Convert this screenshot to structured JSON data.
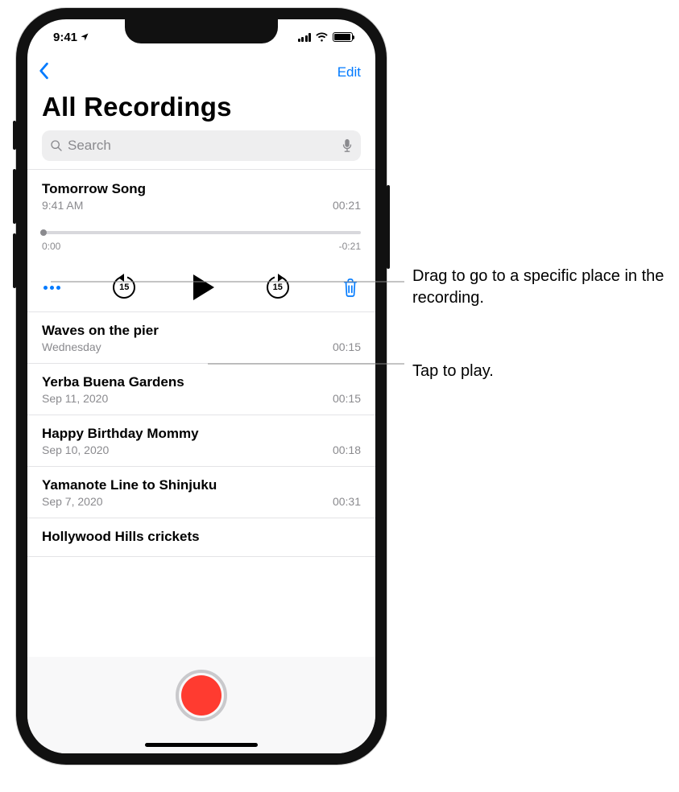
{
  "status": {
    "time": "9:41",
    "location_arrow": "➤"
  },
  "nav": {
    "edit_label": "Edit"
  },
  "page": {
    "title": "All Recordings"
  },
  "search": {
    "placeholder": "Search"
  },
  "expanded_recording": {
    "title": "Tomorrow Song",
    "time_label": "9:41 AM",
    "duration": "00:21",
    "slider_start": "0:00",
    "slider_end": "-0:21",
    "skip_back_num": "15",
    "skip_fwd_num": "15"
  },
  "recordings": [
    {
      "title": "Waves on the pier",
      "date": "Wednesday",
      "duration": "00:15"
    },
    {
      "title": "Yerba Buena Gardens",
      "date": "Sep 11, 2020",
      "duration": "00:15"
    },
    {
      "title": "Happy Birthday Mommy",
      "date": "Sep 10, 2020",
      "duration": "00:18"
    },
    {
      "title": "Yamanote Line to Shinjuku",
      "date": "Sep 7, 2020",
      "duration": "00:31"
    },
    {
      "title": "Hollywood Hills crickets",
      "date": "",
      "duration": ""
    }
  ],
  "callouts": {
    "slider": "Drag to go to a specific place in the recording.",
    "play": "Tap to play."
  }
}
